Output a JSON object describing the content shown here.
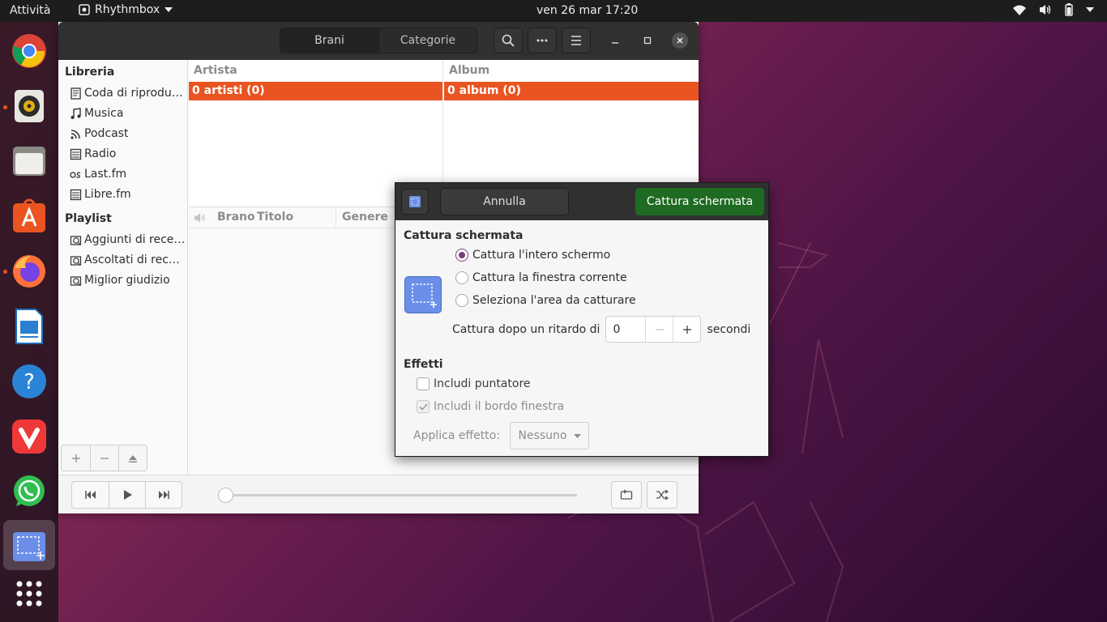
{
  "topbar": {
    "activities": "Attività",
    "app_name": "Rhythmbox",
    "clock": "ven 26 mar  17:20"
  },
  "dock": {
    "apps": [
      "chrome-icon",
      "rhythmbox-icon",
      "files-icon",
      "software-icon",
      "firefox-icon",
      "writer-icon",
      "help-icon",
      "vivaldi-icon",
      "whatsapp-icon",
      "screenshot-icon",
      "show-apps-icon"
    ],
    "running_dots": [
      "rhythmbox",
      "firefox"
    ]
  },
  "rhythmbox": {
    "tabs": [
      "Brani",
      "Categorie"
    ],
    "selected_tab": "Brani",
    "sidebar": {
      "library_heading": "Libreria",
      "library_items": [
        {
          "label": "Coda di riprodu…",
          "icon": "queue-icon"
        },
        {
          "label": "Musica",
          "icon": "music-note-icon"
        },
        {
          "label": "Podcast",
          "icon": "podcast-icon"
        },
        {
          "label": "Radio",
          "icon": "radio-icon"
        },
        {
          "label": "Last.fm",
          "icon": "lastfm-icon"
        },
        {
          "label": "Libre.fm",
          "icon": "librefm-icon"
        }
      ],
      "playlist_heading": "Playlist",
      "playlist_items": [
        {
          "label": "Aggiunti di rece…",
          "icon": "smart-playlist-icon"
        },
        {
          "label": "Ascoltati di rece…",
          "icon": "smart-playlist-icon"
        },
        {
          "label": "Miglior giudizio",
          "icon": "smart-playlist-icon"
        }
      ]
    },
    "browser": {
      "artist_header": "Artista",
      "album_header": "Album",
      "artist_selected": "0 artisti (0)",
      "album_selected": "0 album (0)"
    },
    "tracklist": {
      "columns": [
        "Brano",
        "Titolo",
        "Genere"
      ]
    },
    "accent": "#e95420"
  },
  "screenshot_dialog": {
    "cancel_label": "Annulla",
    "capture_label": "Cattura schermata",
    "capture_heading": "Cattura schermata",
    "options": [
      {
        "label": "Cattura l'intero schermo",
        "selected": true
      },
      {
        "label": "Cattura la finestra corrente",
        "selected": false
      },
      {
        "label": "Seleziona l'area da catturare",
        "selected": false
      }
    ],
    "delay_label": "Cattura dopo un ritardo di",
    "delay_value": "0",
    "delay_unit": "secondi",
    "effects_heading": "Effetti",
    "include_pointer": {
      "label": "Includi puntatore",
      "checked": false,
      "enabled": true
    },
    "include_border": {
      "label": "Includi il bordo finestra",
      "checked": true,
      "enabled": false
    },
    "apply_effect_label": "Applica effetto:",
    "apply_effect_value": "Nessuno",
    "capture_button_color": "#1f6b24"
  }
}
